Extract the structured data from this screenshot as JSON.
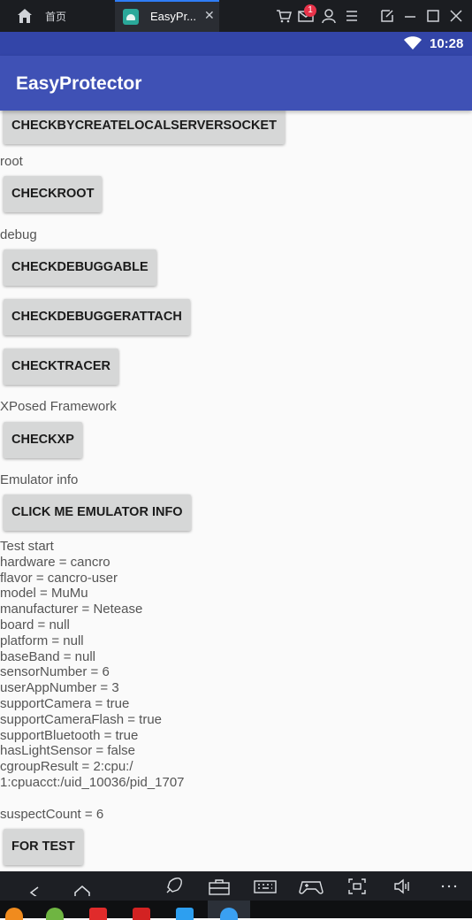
{
  "chrome": {
    "home_tab_label": "首页",
    "app_tab_label": "EasyPr...",
    "app_tab_close": "✕",
    "notification_count": "1"
  },
  "statusbar": {
    "time": "10:28"
  },
  "toolbar": {
    "title": "EasyProtector"
  },
  "content": {
    "buttons": {
      "check_socket": "CHECKBYCREATELOCALSERVERSOCKET",
      "check_root": "CHECKROOT",
      "check_debuggable": "CHECKDEBUGGABLE",
      "check_debugger_attach": "CHECKDEBUGGERATTACH",
      "check_tracer": "CHECKTRACER",
      "check_xp": "CHECKXP",
      "emulator_info": "CLICK ME EMULATOR INFO",
      "for_test": "FOR TEST"
    },
    "labels": {
      "root": "root",
      "debug": "debug",
      "xposed": "XPosed Framework",
      "emulator": "Emulator info"
    },
    "emulator_result": "Test start\nhardware = cancro\nflavor = cancro-user\nmodel = MuMu\nmanufacturer = Netease\nboard = null\nplatform = null\nbaseBand = null\nsensorNumber = 6\nuserAppNumber = 3\nsupportCamera = true\nsupportCameraFlash = true\nsupportBluetooth = true\nhasLightSensor = false\ncgroupResult = 2:cpu:/\n1:cpuacct:/uid_10036/pid_1707\n\nsuspectCount = 6"
  },
  "icons": {
    "home": "home-icon",
    "android_app": "android-app-icon",
    "cart": "cart-icon",
    "mail": "mail-icon",
    "user": "user-icon",
    "menu": "menu-icon",
    "pin": "pin-icon",
    "minimize": "minimize-icon",
    "maximize": "maximize-icon",
    "close": "close-icon",
    "wifi": "wifi-icon"
  },
  "colors": {
    "toolbar": "#3f51b5",
    "statusbar": "#3345a8",
    "button": "#d6d7d7",
    "background": "#fafafa"
  }
}
